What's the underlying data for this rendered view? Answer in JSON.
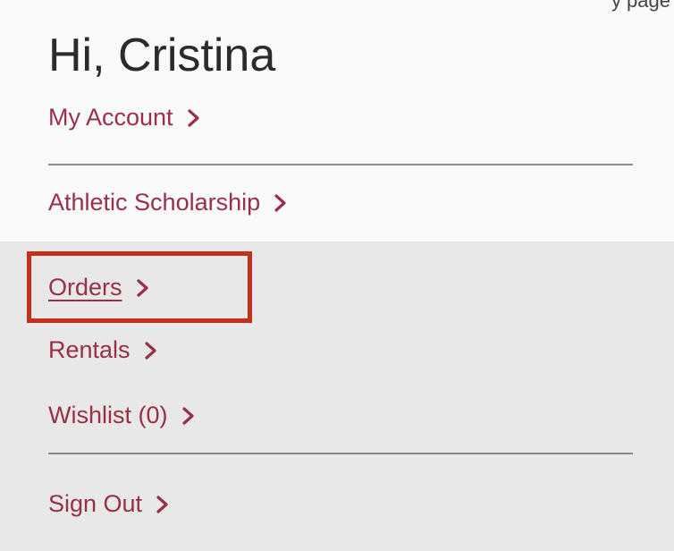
{
  "header_partial": "y  page",
  "greeting": "Hi, Cristina",
  "menu": {
    "my_account": "My Account",
    "athletic_scholarship": "Athletic Scholarship",
    "orders": "Orders",
    "rentals": "Rentals",
    "wishlist": "Wishlist (0)",
    "sign_out": "Sign Out"
  },
  "colors": {
    "link": "#9a3048",
    "highlight_border": "#c4311b",
    "divider": "#8a8a8a",
    "top_panel": "#fafafa",
    "bottom_panel": "#e8e8e8"
  },
  "icons": {
    "chevron": "chevron-right-icon"
  }
}
